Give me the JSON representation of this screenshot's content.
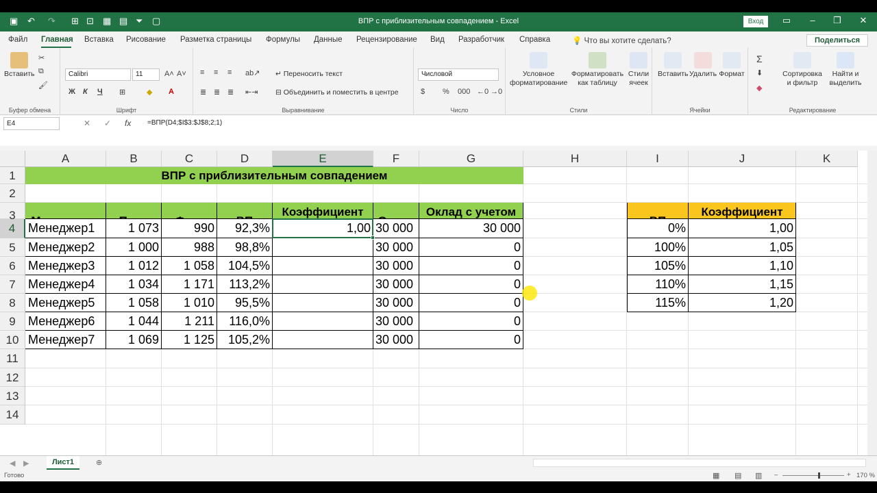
{
  "window": {
    "title": "ВПР с приблизительным совпадением  -  Excel",
    "signin": "Вход"
  },
  "tabs": [
    "Файл",
    "Главная",
    "Вставка",
    "Рисование",
    "Разметка страницы",
    "Формулы",
    "Данные",
    "Рецензирование",
    "Вид",
    "Разработчик",
    "Справка"
  ],
  "tell_me": "Что вы хотите сделать?",
  "share": "Поделиться",
  "ribbon": {
    "paste": "Вставить",
    "clipboard": "Буфер обмена",
    "font_name": "Calibri",
    "font_size": "11",
    "font_group": "Шрифт",
    "bold": "Ж",
    "italic": "К",
    "underline": "Ч",
    "wrap_text": "Переносить текст",
    "merge_center": "Объединить и поместить в центре",
    "alignment": "Выравнивание",
    "number_format": "Числовой",
    "number_group": "Число",
    "cond_format": "Условное форматирование",
    "format_table": "Форматировать как таблицу",
    "cell_styles": "Стили ячеек",
    "styles_group": "Стили",
    "insert": "Вставить",
    "delete": "Удалить",
    "format": "Формат",
    "cells_group": "Ячейки",
    "sort_filter": "Сортировка и фильтр",
    "find_select": "Найти и выделить",
    "editing_group": "Редактирование"
  },
  "formula_bar": {
    "name_box": "E4",
    "formula": "=ВПР(D4;$I$3:$J$8;2;1)"
  },
  "columns": [
    "A",
    "B",
    "C",
    "D",
    "E",
    "F",
    "G",
    "H",
    "I",
    "J",
    "K"
  ],
  "rows": [
    "1",
    "2",
    "3",
    "4",
    "5",
    "6",
    "7",
    "8",
    "9",
    "10",
    "11",
    "12",
    "13",
    "14"
  ],
  "sheet": {
    "title": "ВПР с приблизительным совпадением",
    "headers": [
      "Менеджеры",
      "План",
      "Факт",
      "ВП",
      "Коэффициент премирования",
      "Оклад",
      "Оклад с учетом премии"
    ],
    "data": [
      [
        "Менеджер1",
        "1 073",
        "990",
        "92,3%",
        "1,00",
        "30 000",
        "30 000"
      ],
      [
        "Менеджер2",
        "1 000",
        "988",
        "98,8%",
        "",
        "30 000",
        "0"
      ],
      [
        "Менеджер3",
        "1 012",
        "1 058",
        "104,5%",
        "",
        "30 000",
        "0"
      ],
      [
        "Менеджер4",
        "1 034",
        "1 171",
        "113,2%",
        "",
        "30 000",
        "0"
      ],
      [
        "Менеджер5",
        "1 058",
        "1 010",
        "95,5%",
        "",
        "30 000",
        "0"
      ],
      [
        "Менеджер6",
        "1 044",
        "1 211",
        "116,0%",
        "",
        "30 000",
        "0"
      ],
      [
        "Менеджер7",
        "1 069",
        "1 125",
        "105,2%",
        "",
        "30 000",
        "0"
      ]
    ],
    "lookup_headers": [
      "ВП",
      "Коэффициент премирования"
    ],
    "lookup": [
      [
        "0%",
        "1,00"
      ],
      [
        "100%",
        "1,05"
      ],
      [
        "105%",
        "1,10"
      ],
      [
        "110%",
        "1,15"
      ],
      [
        "115%",
        "1,20"
      ]
    ]
  },
  "sheet_tab": "Лист1",
  "status": {
    "ready": "Готово",
    "zoom": "170 %"
  },
  "colors": {
    "accent": "#217346",
    "header_green": "#92d050",
    "header_yellow": "#fac51c"
  }
}
